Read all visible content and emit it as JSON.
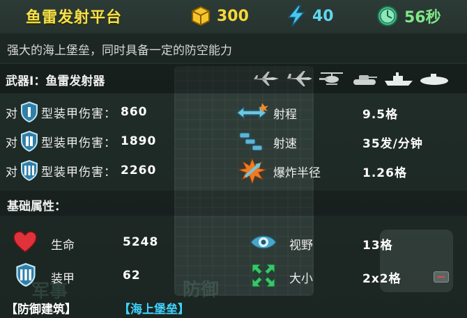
{
  "header": {
    "title": "鱼雷发射平台",
    "gold": "300",
    "energy": "40",
    "time": "56秒"
  },
  "description": "强大的海上堡垒，同时具备一定的防空能力",
  "weapon": {
    "label": "武器Ⅰ：鱼雷发射器",
    "targets": [
      "bomber-icon",
      "fighter-jet-icon",
      "helicopter-icon",
      "tank-icon",
      "ship-icon",
      "submarine-icon"
    ]
  },
  "armor_damage": [
    {
      "prefix": "对",
      "tier": "I",
      "label": "型装甲伤害：",
      "value": "860"
    },
    {
      "prefix": "对",
      "tier": "II",
      "label": "型装甲伤害：",
      "value": "1890"
    },
    {
      "prefix": "对",
      "tier": "III",
      "label": "型装甲伤害：",
      "value": "2260"
    }
  ],
  "weapon_stats": [
    {
      "icon": "range-arrow-icon",
      "name": "射程",
      "value": "9.5格"
    },
    {
      "icon": "fire-rate-icon",
      "name": "射速",
      "value": "35发/分钟"
    },
    {
      "icon": "blast-radius-icon",
      "name": "爆炸半径",
      "value": "1.26格"
    }
  ],
  "base_label": "基础属性：",
  "base_stats": [
    {
      "icon": "heart-icon",
      "name": "生命",
      "value": "5248"
    },
    {
      "icon": "eye-icon",
      "name": "视野",
      "value": "13格"
    },
    {
      "icon": "armor-shield-icon",
      "name": "装甲",
      "value": "62"
    },
    {
      "icon": "size-arrows-icon",
      "name": "大小",
      "value": "2x2格"
    }
  ],
  "footer": {
    "tag1": "【防御建筑】",
    "tag2": "【海上堡垒】"
  },
  "background_words": [
    "军事",
    "防御"
  ],
  "colors": {
    "title": "#f6e04a",
    "gold": "#f6d738",
    "energy": "#5fd8ee",
    "time": "#7ee88a",
    "tag2": "#3fd4ff",
    "heart": "#e0323a"
  }
}
